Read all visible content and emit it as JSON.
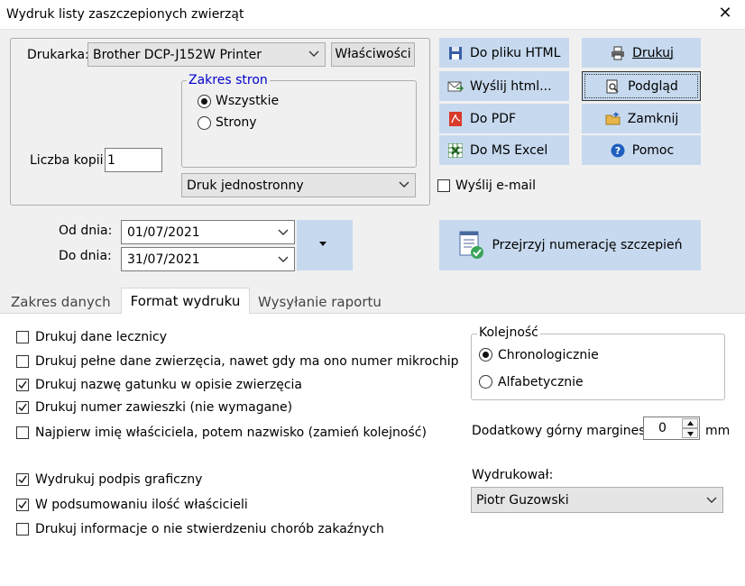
{
  "window": {
    "title": "Wydruk listy zaszczepionych zwierząt"
  },
  "printer": {
    "label": "Drukarka:",
    "selected": "Brother DCP-J152W Printer",
    "properties_button": "Właściwości",
    "copies_label": "Liczba kopii:",
    "copies_value": "1",
    "page_range": {
      "legend": "Zakres stron",
      "all": "Wszystkie",
      "pages": "Strony",
      "selected": "all"
    },
    "duplex_selected": "Druk jednostronny"
  },
  "actions": {
    "to_html": "Do pliku HTML",
    "send_html": "Wyślij html...",
    "to_pdf": "Do PDF",
    "to_excel": "Do MS Excel",
    "print": "Drukuj",
    "preview": "Podgląd",
    "close": "Zamknij",
    "help": "Pomoc",
    "send_email": "Wyślij e-mail",
    "send_email_checked": false,
    "review_numbering": "Przejrzyj numerację szczepień"
  },
  "dates": {
    "from_label": "Od dnia:",
    "from_value": "01/07/2021",
    "to_label": "Do dnia:",
    "to_value": "31/07/2021"
  },
  "tabs": [
    {
      "label": "Zakres danych",
      "active": false
    },
    {
      "label": "Format wydruku",
      "active": true
    },
    {
      "label": "Wysyłanie raportu",
      "active": false
    }
  ],
  "options": [
    {
      "label": "Drukuj dane lecznicy",
      "checked": false
    },
    {
      "label": "Drukuj pełne dane zwierzęcia, nawet gdy ma ono numer mikrochip",
      "checked": false
    },
    {
      "label": "Drukuj nazwę gatunku w opisie zwierzęcia",
      "checked": true
    },
    {
      "label": "Drukuj numer zawieszki (nie wymagane)",
      "checked": true
    },
    {
      "label": "Najpierw imię właściciela, potem nazwisko (zamień kolejność)",
      "checked": false
    },
    {
      "label": "Wydrukuj podpis graficzny",
      "checked": true
    },
    {
      "label": "W podsumowaniu ilość właścicieli",
      "checked": true
    },
    {
      "label": "Drukuj informacje o nie stwierdzeniu chorób zakaźnych",
      "checked": false
    }
  ],
  "order": {
    "legend": "Kolejność",
    "chronological": "Chronologicznie",
    "alphabetical": "Alfabetycznie",
    "selected": "chronological"
  },
  "margin": {
    "label": "Dodatkowy górny margines:",
    "value": "0",
    "unit": "mm"
  },
  "printed_by": {
    "label": "Wydrukował:",
    "selected": "Piotr Guzowski"
  },
  "colors": {
    "button_blue": "#c6d9ee",
    "window_bg": "#f0f0f0",
    "legend_blue": "#0000cc"
  }
}
